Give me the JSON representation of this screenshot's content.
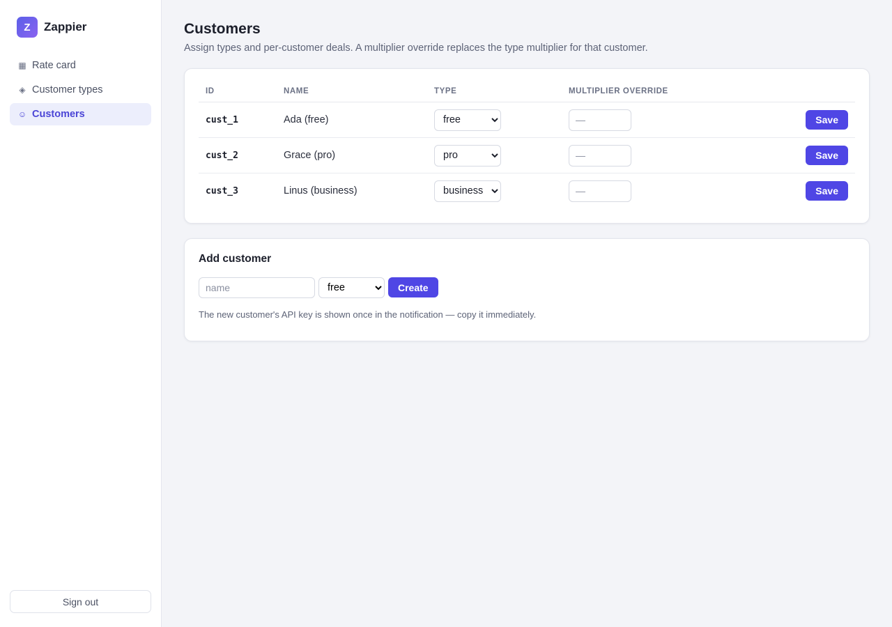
{
  "brand": {
    "logo_letter": "Z",
    "name": "Zappier"
  },
  "sidebar": {
    "items": [
      {
        "label": "Rate card",
        "icon": "▦",
        "active": false
      },
      {
        "label": "Customer types",
        "icon": "◈",
        "active": false
      },
      {
        "label": "Customers",
        "icon": "☺",
        "active": true
      }
    ],
    "signout_label": "Sign out"
  },
  "page": {
    "title": "Customers",
    "subtitle": "Assign types and per-customer deals. A multiplier override replaces the type multiplier for that customer."
  },
  "table": {
    "headers": [
      "ID",
      "NAME",
      "TYPE",
      "MULTIPLIER OVERRIDE"
    ],
    "type_options": [
      "free",
      "pro",
      "business"
    ],
    "override_placeholder": "—",
    "save_label": "Save",
    "rows": [
      {
        "id": "cust_1",
        "name": "Ada (free)",
        "type": "free"
      },
      {
        "id": "cust_2",
        "name": "Grace (pro)",
        "type": "pro"
      },
      {
        "id": "cust_3",
        "name": "Linus (business)",
        "type": "business"
      }
    ]
  },
  "add_customer": {
    "title": "Add customer",
    "name_placeholder": "name",
    "selected_type": "free",
    "create_label": "Create",
    "hint": "The new customer's API key is shown once in the notification — copy it immediately."
  },
  "colors": {
    "accent": "#4f46e5",
    "active_nav_bg": "#eceefc",
    "page_bg": "#f3f4f8"
  }
}
